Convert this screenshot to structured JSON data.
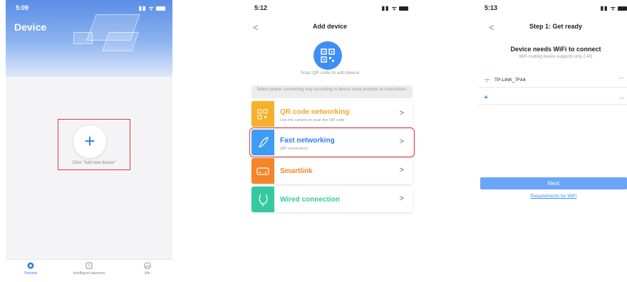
{
  "panel1": {
    "time": "5:09",
    "title": "Device",
    "add_label": "Click \"Add new device\"",
    "tabs": [
      {
        "label": "Yoosee",
        "icon": "home-icon"
      },
      {
        "label": "Intelligent daemon",
        "icon": "shield-icon"
      },
      {
        "label": "Me",
        "icon": "profile-icon"
      }
    ]
  },
  "panel2": {
    "time": "5:12",
    "back": "<",
    "title": "Add device",
    "scan_text": "Scan QR code to add device",
    "hint": "Select proper connecting way according to device voice prompts or instructions.",
    "options": [
      {
        "title": "QR code networking",
        "subtitle": "Use the camera to scan the QR code",
        "color": "#f6b12a",
        "icon": "qr-icon"
      },
      {
        "title": "Fast networking",
        "subtitle": "(AP connection)",
        "color": "#3f9cf5",
        "icon": "rocket-icon"
      },
      {
        "title": "Smartlink",
        "subtitle": "",
        "color": "#f5852a",
        "icon": "router-icon"
      },
      {
        "title": "Wired connection",
        "subtitle": "",
        "color": "#35c9a0",
        "icon": "plug-icon"
      }
    ],
    "arrow": ">"
  },
  "panel3": {
    "time": "5:13",
    "back": "<",
    "title": "Step 1: Get ready",
    "heading": "Device needs WiFi to connect",
    "subheading": "WiFi routing device supports only 2.4G",
    "wifi_name": "TP-LINK_7FA4",
    "password": "",
    "next": "Next",
    "requirements": "Requirements for WiFi"
  },
  "colors": {
    "accent": "#2f7cf0",
    "highlight": "#e0393e",
    "button": "#6aa5f8"
  }
}
